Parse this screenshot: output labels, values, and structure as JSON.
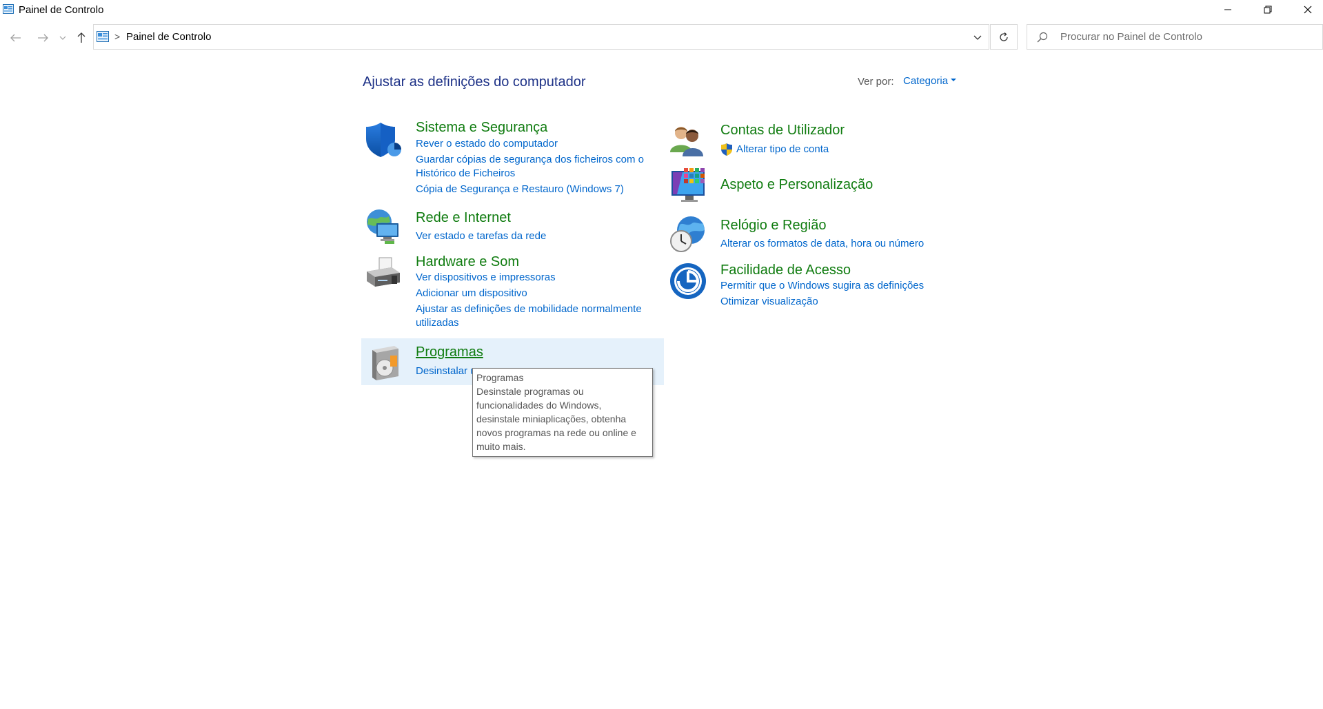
{
  "window": {
    "title": "Painel de Controlo"
  },
  "address": {
    "crumb": "Painel de Controlo",
    "separator": ">"
  },
  "search": {
    "placeholder": "Procurar no Painel de Controlo"
  },
  "header": {
    "title": "Ajustar as definições do computador",
    "view_by_label": "Ver por:",
    "view_by_value": "Categoria"
  },
  "categories": {
    "system": {
      "title": "Sistema e Segurança",
      "links": [
        "Rever o estado do computador",
        "Guardar cópias de segurança dos ficheiros com o",
        "Histórico de Ficheiros",
        "Cópia de Segurança e Restauro (Windows 7)"
      ]
    },
    "network": {
      "title": "Rede e Internet",
      "links": [
        "Ver estado e tarefas da rede"
      ]
    },
    "hardware": {
      "title": "Hardware e Som",
      "links": [
        "Ver dispositivos e impressoras",
        "Adicionar um dispositivo",
        "Ajustar as definições de mobilidade normalmente",
        "utilizadas"
      ]
    },
    "programs": {
      "title": "Programas",
      "links": [
        "Desinstalar u"
      ]
    },
    "accounts": {
      "title": "Contas de Utilizador",
      "links": [
        "Alterar tipo de conta"
      ]
    },
    "appearance": {
      "title": "Aspeto e Personalização",
      "links": []
    },
    "clock": {
      "title": "Relógio e Região",
      "links": [
        "Alterar os formatos de data, hora ou número"
      ]
    },
    "ease": {
      "title": "Facilidade de Acesso",
      "links": [
        "Permitir que o Windows sugira as definições",
        "Otimizar visualização"
      ]
    }
  },
  "tooltip": {
    "title": "Programas",
    "lines": [
      "Desinstale programas ou",
      "funcionalidades do Windows,",
      "desinstale miniaplicações, obtenha",
      "novos programas na rede ou online e",
      "muito mais."
    ]
  },
  "colors": {
    "title_blue": "#1e3287",
    "link_blue": "#0066cc",
    "category_green": "#107c10",
    "hover_bg": "#e5f1fb"
  }
}
